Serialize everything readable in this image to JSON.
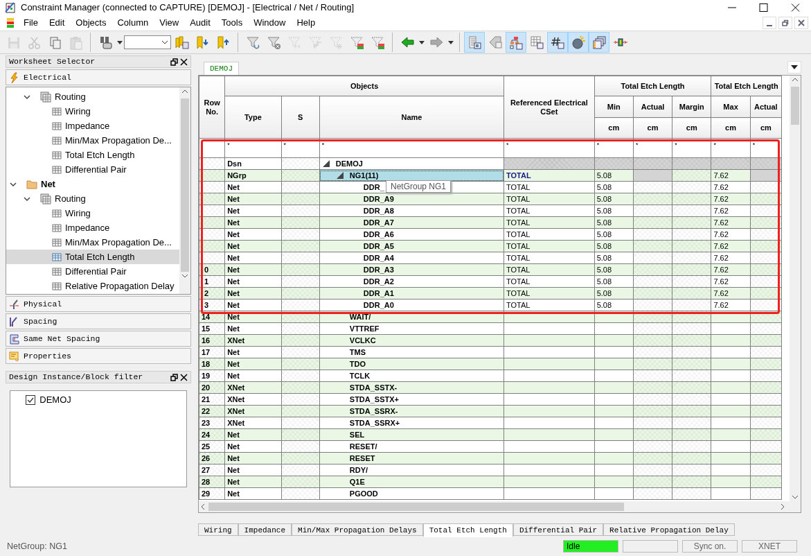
{
  "window": {
    "title": "Constraint Manager (connected to CAPTURE) [DEMOJ] - [Electrical / Net / Routing]"
  },
  "menu": [
    "File",
    "Edit",
    "Objects",
    "Column",
    "View",
    "Audit",
    "Tools",
    "Window",
    "Help"
  ],
  "toolbar": [
    {
      "kind": "save",
      "disabled": true
    },
    {
      "kind": "cut",
      "disabled": true
    },
    {
      "kind": "copy",
      "disabled": false
    },
    {
      "kind": "paste",
      "disabled": true
    },
    {
      "kind": "separator"
    },
    {
      "kind": "objects",
      "disabled": false
    },
    {
      "kind": "caret"
    },
    {
      "kind": "combo"
    },
    {
      "kind": "bookmarks",
      "disabled": false
    },
    {
      "kind": "bookmark-down",
      "disabled": false
    },
    {
      "kind": "bookmark-up",
      "disabled": false
    },
    {
      "kind": "separator"
    },
    {
      "kind": "filter-cycle",
      "disabled": false
    },
    {
      "kind": "filter-clear",
      "disabled": false
    },
    {
      "kind": "filter-bowtie",
      "disabled": true
    },
    {
      "kind": "filter-step",
      "disabled": true
    },
    {
      "kind": "filter-star",
      "disabled": true
    },
    {
      "kind": "filter-table",
      "disabled": false
    },
    {
      "kind": "filter-table",
      "disabled": false
    },
    {
      "kind": "separator"
    },
    {
      "kind": "back",
      "disabled": false
    },
    {
      "kind": "caret"
    },
    {
      "kind": "forward",
      "disabled": false
    },
    {
      "kind": "caret"
    },
    {
      "kind": "separator"
    },
    {
      "kind": "sheet",
      "on": true
    },
    {
      "kind": "tag",
      "on": false
    },
    {
      "kind": "hierarchy",
      "on": true
    },
    {
      "kind": "grid",
      "on": false
    },
    {
      "kind": "hash",
      "on": true
    },
    {
      "kind": "bomb",
      "on": true
    },
    {
      "kind": "windows",
      "on": true
    },
    {
      "kind": "connector",
      "on": false
    }
  ],
  "worksheet_selector": {
    "title": "Worksheet Selector",
    "sections": [
      {
        "label": "Electrical",
        "kind": "electrical",
        "expanded": true
      },
      {
        "label": "Physical",
        "kind": "physical",
        "expanded": false
      },
      {
        "label": "Spacing",
        "kind": "spacing",
        "expanded": false
      },
      {
        "label": "Same Net Spacing",
        "kind": "same-net",
        "expanded": false
      },
      {
        "label": "Properties",
        "kind": "properties",
        "expanded": false
      }
    ],
    "tree": [
      {
        "label": "Routing",
        "kind": "group",
        "expanded": true,
        "children": [
          {
            "label": "Wiring",
            "kind": "sheet",
            "selected": false
          },
          {
            "label": "Impedance",
            "kind": "sheet",
            "selected": false
          },
          {
            "label": "Min/Max Propagation De...",
            "kind": "sheet",
            "selected": false
          },
          {
            "label": "Total Etch Length",
            "kind": "sheet",
            "selected": false
          },
          {
            "label": "Differential Pair",
            "kind": "sheet",
            "selected": false
          }
        ]
      },
      {
        "label": "Net",
        "kind": "folder",
        "expanded": true,
        "children": [
          {
            "label": "Routing",
            "kind": "group",
            "expanded": true,
            "children": [
              {
                "label": "Wiring",
                "kind": "sheet",
                "selected": false
              },
              {
                "label": "Impedance",
                "kind": "sheet",
                "selected": false
              },
              {
                "label": "Min/Max Propagation De...",
                "kind": "sheet",
                "selected": false
              },
              {
                "label": "Total Etch Length",
                "kind": "sheet",
                "selected": true
              },
              {
                "label": "Differential Pair",
                "kind": "sheet",
                "selected": false
              },
              {
                "label": "Relative Propagation Delay",
                "kind": "sheet",
                "selected": false
              }
            ]
          }
        ]
      }
    ]
  },
  "design_filter": {
    "title": "Design Instance/Block filter",
    "items": [
      {
        "label": "DEMOJ",
        "checked": true
      }
    ]
  },
  "document_tab": "DEMOJ",
  "table": {
    "header": {
      "row_no": "Row No.",
      "objects": "Objects",
      "type": "Type",
      "s": "S",
      "name": "Name",
      "cset": "Referenced Electrical CSet",
      "group1": "Total Etch Length",
      "min": "Min",
      "actual": "Actual",
      "margin": "Margin",
      "group2": "Total Etch Length",
      "max": "Max",
      "actual2": "Actual",
      "units": [
        "cm",
        "cm",
        "cm",
        "cm",
        "cm"
      ]
    },
    "filters": [
      "*",
      "*",
      "*",
      "*",
      "*",
      "*",
      "*",
      "*",
      "*"
    ],
    "rows": [
      {
        "kind": "design",
        "type": "Dsn",
        "name": "DEMOJ",
        "expanded": true,
        "selected": false,
        "children": [
          {
            "kind": "group",
            "type": "NGrp",
            "name": "NG1(11)",
            "cset": "TOTAL",
            "min": "5.08",
            "max": "7.62",
            "expanded": true,
            "selected": true,
            "children": [
              {
                "kind": "net",
                "type": "Net",
                "name": "DDR_",
                "cset": "TOTAL",
                "min": "5.08",
                "max": "7.62",
                "selected": false
              },
              {
                "kind": "net",
                "type": "Net",
                "name": "DDR_A9",
                "cset": "TOTAL",
                "min": "5.08",
                "max": "7.62",
                "selected": false
              },
              {
                "kind": "net",
                "type": "Net",
                "name": "DDR_A8",
                "cset": "TOTAL",
                "min": "5.08",
                "max": "7.62",
                "selected": false
              },
              {
                "kind": "net",
                "type": "Net",
                "name": "DDR_A7",
                "cset": "TOTAL",
                "min": "5.08",
                "max": "7.62",
                "selected": false
              },
              {
                "kind": "net",
                "type": "Net",
                "name": "DDR_A6",
                "cset": "TOTAL",
                "min": "5.08",
                "max": "7.62",
                "selected": false
              },
              {
                "kind": "net",
                "type": "Net",
                "name": "DDR_A5",
                "cset": "TOTAL",
                "min": "5.08",
                "max": "7.62",
                "selected": false
              },
              {
                "kind": "net",
                "type": "Net",
                "name": "DDR_A4",
                "cset": "TOTAL",
                "min": "5.08",
                "max": "7.62",
                "selected": false
              },
              {
                "kind": "net",
                "row_no": "0",
                "type": "Net",
                "name": "DDR_A3",
                "cset": "TOTAL",
                "min": "5.08",
                "max": "7.62",
                "selected": false
              },
              {
                "kind": "net",
                "row_no": "1",
                "type": "Net",
                "name": "DDR_A2",
                "cset": "TOTAL",
                "min": "5.08",
                "max": "7.62",
                "selected": false
              },
              {
                "kind": "net",
                "row_no": "2",
                "type": "Net",
                "name": "DDR_A1",
                "cset": "TOTAL",
                "min": "5.08",
                "max": "7.62",
                "selected": false
              },
              {
                "kind": "net",
                "row_no": "3",
                "type": "Net",
                "name": "DDR_A0",
                "cset": "TOTAL",
                "min": "5.08",
                "max": "7.62",
                "selected": false
              }
            ]
          },
          {
            "kind": "net",
            "row_no": "14",
            "type": "Net",
            "name": "WAIT/",
            "selected": false
          },
          {
            "kind": "net",
            "row_no": "15",
            "type": "Net",
            "name": "VTTREF",
            "selected": false
          },
          {
            "kind": "net",
            "row_no": "16",
            "type": "XNet",
            "name": "VCLKC",
            "selected": false
          },
          {
            "kind": "net",
            "row_no": "17",
            "type": "Net",
            "name": "TMS",
            "selected": false
          },
          {
            "kind": "net",
            "row_no": "18",
            "type": "Net",
            "name": "TDO",
            "selected": false
          },
          {
            "kind": "net",
            "row_no": "19",
            "type": "Net",
            "name": "TCLK",
            "selected": false
          },
          {
            "kind": "net",
            "row_no": "20",
            "type": "XNet",
            "name": "STDA_SSTX-",
            "selected": false
          },
          {
            "kind": "net",
            "row_no": "21",
            "type": "XNet",
            "name": "STDA_SSTX+",
            "selected": false
          },
          {
            "kind": "net",
            "row_no": "22",
            "type": "XNet",
            "name": "STDA_SSRX-",
            "selected": false
          },
          {
            "kind": "net",
            "row_no": "23",
            "type": "XNet",
            "name": "STDA_SSRX+",
            "selected": false
          },
          {
            "kind": "net",
            "row_no": "24",
            "type": "Net",
            "name": "SEL",
            "selected": false
          },
          {
            "kind": "net",
            "row_no": "25",
            "type": "Net",
            "name": "RESET/",
            "selected": false
          },
          {
            "kind": "net",
            "row_no": "26",
            "type": "Net",
            "name": "RESET",
            "selected": false
          },
          {
            "kind": "net",
            "row_no": "27",
            "type": "Net",
            "name": "RDY/",
            "selected": false
          },
          {
            "kind": "net",
            "row_no": "28",
            "type": "Net",
            "name": "Q1E",
            "selected": false
          },
          {
            "kind": "net",
            "row_no": "29",
            "type": "Net",
            "name": "PGOOD",
            "selected": false
          }
        ]
      }
    ]
  },
  "tooltip": {
    "text": "NetGroup NG1"
  },
  "sheet_tabs": [
    {
      "label": "Wiring",
      "selected": false
    },
    {
      "label": "Impedance",
      "selected": false
    },
    {
      "label": "Min/Max Propagation Delays",
      "selected": false
    },
    {
      "label": "Total Etch Length",
      "selected": true
    },
    {
      "label": "Differential Pair",
      "selected": false
    },
    {
      "label": "Relative Propagation Delay",
      "selected": false
    }
  ],
  "status_bar": {
    "text": "NetGroup: NG1",
    "state": "Idle",
    "sync": "Sync on.",
    "mode": "XNET"
  }
}
